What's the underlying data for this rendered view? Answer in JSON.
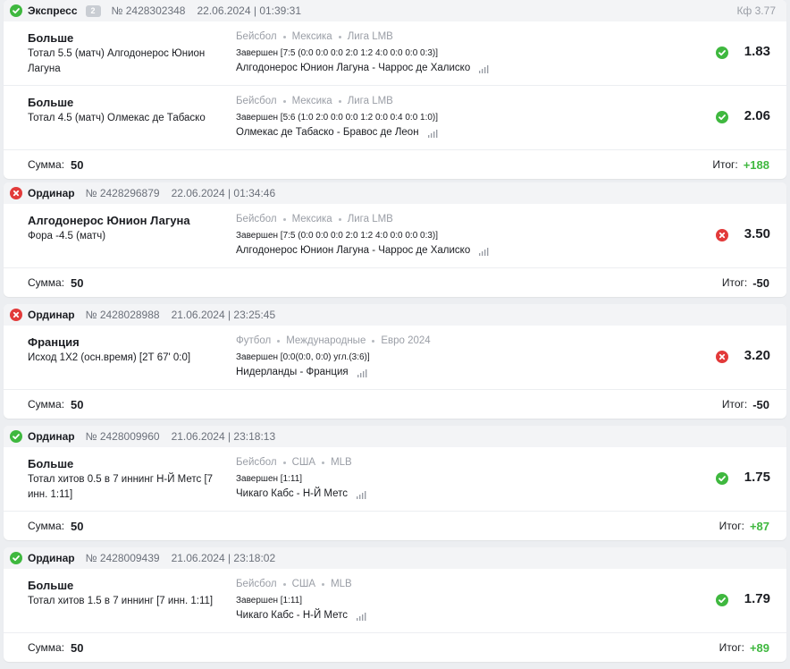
{
  "colors": {
    "win": "#3fb83f",
    "loss": "#e23a3a",
    "muted": "#9a9ea6",
    "background": "#eceef1"
  },
  "labels": {
    "sum": "Сумма:",
    "total": "Итог:"
  },
  "bets": [
    {
      "status": "win",
      "status_icon": "check-circle-icon",
      "type": "Экспресс",
      "badge": "2",
      "number": "№ 2428302348",
      "date": "22.06.2024 | 01:39:31",
      "coef": "Кф 3.77",
      "sum": "50",
      "total": "+188",
      "events": [
        {
          "outcome": "Больше",
          "market": "Тотал 5.5 (матч) Алгодонерос Юнион Лагуна",
          "sport": "Бейсбол",
          "country": "Мексика",
          "league": "Лига LMB",
          "score": "Завершен [7:5 (0:0 0:0 0:0 2:0 1:2 4:0 0:0 0:0 0:3)]",
          "teams": "Алгодонерос Юнион Лагуна - Чаррос де Халиско",
          "result": "win",
          "odds": "1.83"
        },
        {
          "outcome": "Больше",
          "market": "Тотал 4.5 (матч) Олмекас де Табаско",
          "sport": "Бейсбол",
          "country": "Мексика",
          "league": "Лига LMB",
          "score": "Завершен [5:6 (1:0 2:0 0:0 0:0 1:2 0:0 0:4 0:0 1:0)]",
          "teams": "Олмекас де Табаско - Бравос де Леон",
          "result": "win",
          "odds": "2.06"
        }
      ]
    },
    {
      "status": "loss",
      "status_icon": "cross-circle-icon",
      "type": "Ординар",
      "badge": "",
      "number": "№ 2428296879",
      "date": "22.06.2024 | 01:34:46",
      "coef": "",
      "sum": "50",
      "total": "-50",
      "events": [
        {
          "outcome": "Алгодонерос Юнион Лагуна",
          "market": "Фора -4.5 (матч)",
          "sport": "Бейсбол",
          "country": "Мексика",
          "league": "Лига LMB",
          "score": "Завершен [7:5 (0:0 0:0 0:0 2:0 1:2 4:0 0:0 0:0 0:3)]",
          "teams": "Алгодонерос Юнион Лагуна - Чаррос де Халиско",
          "result": "loss",
          "odds": "3.50"
        }
      ]
    },
    {
      "status": "loss",
      "status_icon": "cross-circle-icon",
      "type": "Ординар",
      "badge": "",
      "number": "№ 2428028988",
      "date": "21.06.2024 | 23:25:45",
      "coef": "",
      "sum": "50",
      "total": "-50",
      "events": [
        {
          "outcome": "Франция",
          "market": "Исход 1X2 (осн.время) [2Т 67' 0:0]",
          "sport": "Футбол",
          "country": "Международные",
          "league": "Евро 2024",
          "score": "Завершен [0:0(0:0, 0:0) угл.(3:6)]",
          "teams": "Нидерланды - Франция",
          "result": "loss",
          "odds": "3.20"
        }
      ]
    },
    {
      "status": "win",
      "status_icon": "check-circle-icon",
      "type": "Ординар",
      "badge": "",
      "number": "№ 2428009960",
      "date": "21.06.2024 | 23:18:13",
      "coef": "",
      "sum": "50",
      "total": "+87",
      "events": [
        {
          "outcome": "Больше",
          "market": "Тотал хитов 0.5 в 7 иннинг Н-Й Метс [7 инн. 1:11]",
          "sport": "Бейсбол",
          "country": "США",
          "league": "MLB",
          "score": "Завершен [1:11]",
          "teams": "Чикаго Кабс - Н-Й Метс",
          "result": "win",
          "odds": "1.75"
        }
      ]
    },
    {
      "status": "win",
      "status_icon": "check-circle-icon",
      "type": "Ординар",
      "badge": "",
      "number": "№ 2428009439",
      "date": "21.06.2024 | 23:18:02",
      "coef": "",
      "sum": "50",
      "total": "+89",
      "events": [
        {
          "outcome": "Больше",
          "market": "Тотал хитов 1.5 в 7 иннинг [7 инн. 1:11]",
          "sport": "Бейсбол",
          "country": "США",
          "league": "MLB",
          "score": "Завершен [1:11]",
          "teams": "Чикаго Кабс - Н-Й Метс",
          "result": "win",
          "odds": "1.79"
        }
      ]
    }
  ]
}
